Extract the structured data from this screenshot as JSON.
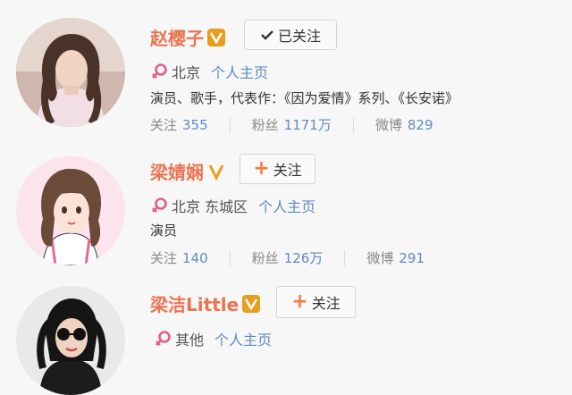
{
  "users": [
    {
      "name": "赵樱子",
      "follow_label": "已关注",
      "followed": true,
      "location": "北京",
      "homepage_label": "个人主页",
      "bio": "演员、歌手，代表作：《因为爱情》系列、《长安诺》",
      "stats": [
        {
          "label": "关注",
          "value": "355"
        },
        {
          "label": "粉丝",
          "value": "1171万"
        },
        {
          "label": "微博",
          "value": "829"
        }
      ]
    },
    {
      "name": "梁婧娴",
      "follow_label": "关注",
      "followed": false,
      "location": "北京 东城区",
      "homepage_label": "个人主页",
      "bio": "演员",
      "stats": [
        {
          "label": "关注",
          "value": "140"
        },
        {
          "label": "粉丝",
          "value": "126万"
        },
        {
          "label": "微博",
          "value": "291"
        }
      ]
    },
    {
      "name": "梁洁Little",
      "follow_label": "关注",
      "followed": false,
      "location": "其他",
      "homepage_label": "个人主页"
    }
  ],
  "colors": {
    "name": "#eb7350",
    "link": "#5d8bc5",
    "badge": "#e89e1d",
    "female_icon": "#e35d8d",
    "plus": "#f77c3d"
  },
  "icons": {
    "verified": "verified-v-icon",
    "gender": "female-icon",
    "followed": "check-icon",
    "follow": "plus-icon"
  }
}
